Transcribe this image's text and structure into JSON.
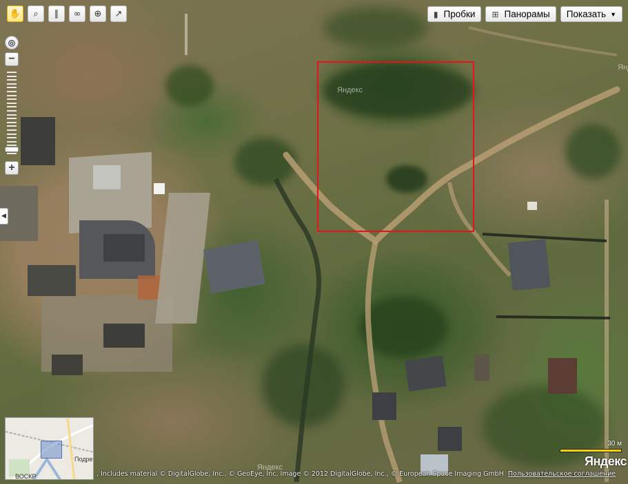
{
  "toolbar": {
    "tools": [
      {
        "name": "hand-tool-button",
        "icon": "hand-icon",
        "glyph": "✋",
        "active": true
      },
      {
        "name": "magnifier-tool-button",
        "icon": "magnifier-icon",
        "glyph": "⌕",
        "active": false
      },
      {
        "name": "ruler-tool-button",
        "icon": "ruler-icon",
        "glyph": "∥",
        "active": false
      },
      {
        "name": "route-tool-button",
        "icon": "route-icon",
        "glyph": "∞",
        "active": false
      },
      {
        "name": "add-object-tool-button",
        "icon": "add-object-icon",
        "glyph": "⊕",
        "active": false
      },
      {
        "name": "info-cursor-tool-button",
        "icon": "cursor-question-icon",
        "glyph": "↗",
        "active": false
      }
    ]
  },
  "top_controls": {
    "traffic": "Пробки",
    "panoramas": "Панорамы",
    "show": "Показать",
    "show_arrow": "▼"
  },
  "zoom": {
    "plus": "+",
    "minus": "−",
    "level_fraction": 0.93
  },
  "map": {
    "watermark_center": "Яндекс",
    "watermark_bottom": "Яндекс",
    "watermark_right": "Янд"
  },
  "minimap": {
    "label_1": "Подре",
    "label_2": "ВОСКР"
  },
  "footer": {
    "copyright": ", Includes material © DigitalGlobe, Inc., © GeoEye, Inc, Image © 2012 DigitalGlobe, Inc., © European Space Imaging GmbH",
    "agreement": "Пользовательское соглашение"
  },
  "scale": {
    "label": "30 м"
  },
  "logo": "Яндекс",
  "colors": {
    "selection": "#e8131a",
    "scale_bar": "#f5d400",
    "active_tool": "#ffe58a"
  }
}
